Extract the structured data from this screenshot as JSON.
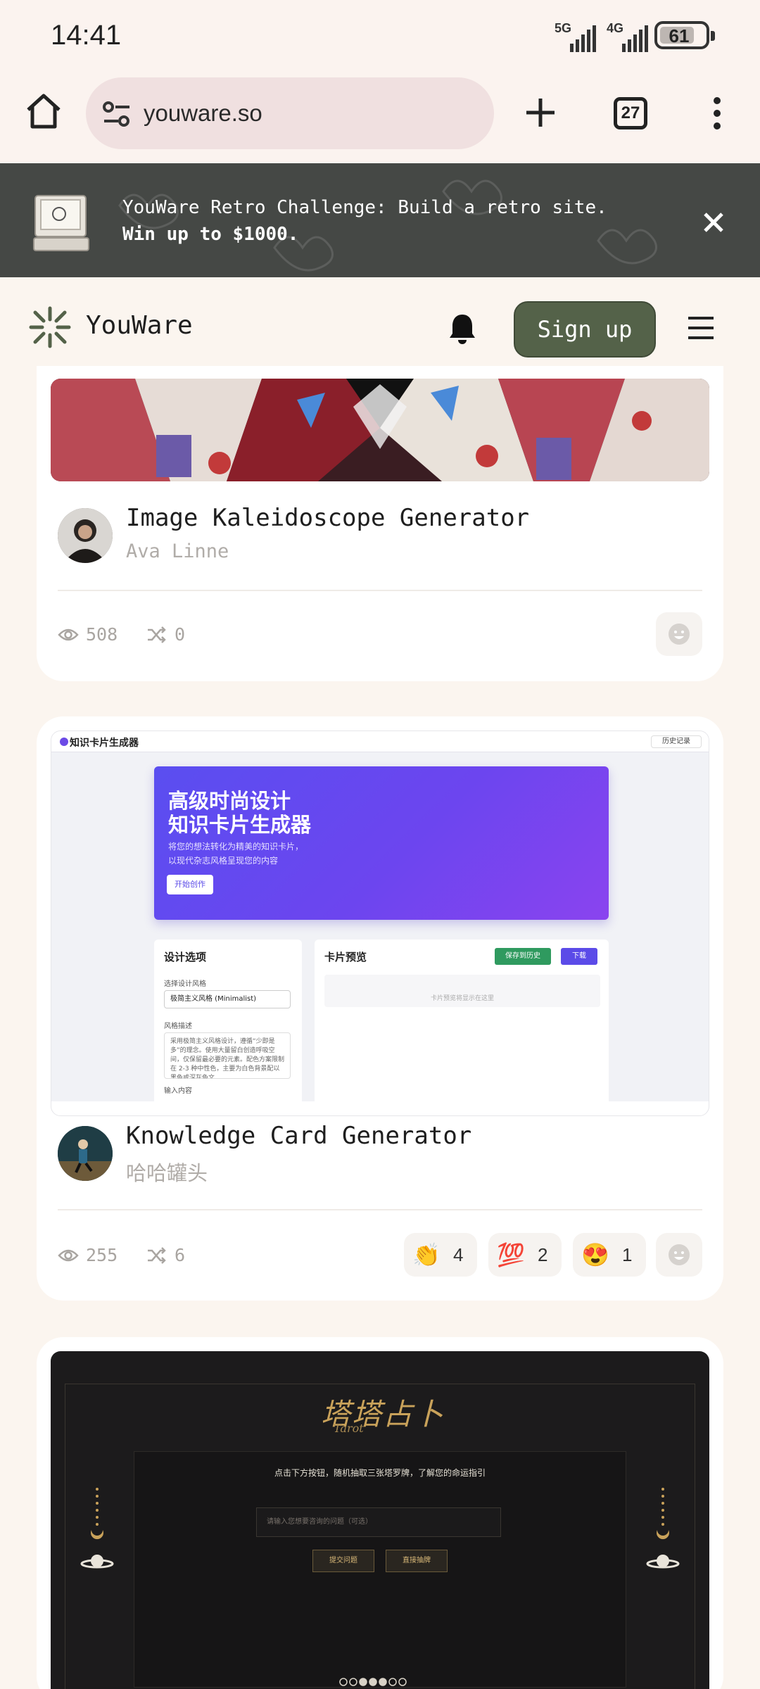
{
  "status_bar": {
    "time": "14:41",
    "net1": "5G",
    "net2": "4G",
    "battery": "61"
  },
  "browser": {
    "url": "youware.so",
    "tab_count": "27"
  },
  "banner": {
    "line1": "YouWare Retro Challenge: Build a retro site.",
    "line2": "Win up to $1000."
  },
  "header": {
    "brand": "YouWare",
    "signup": "Sign up"
  },
  "cards": [
    {
      "title": "Image Kaleidoscope Generator",
      "author": "Ava Linne",
      "views": "508",
      "remixes": "0"
    },
    {
      "title": "Knowledge Card Generator",
      "author": "哈哈罐头",
      "views": "255",
      "remixes": "6",
      "reactions": [
        {
          "emoji": "👏",
          "count": "4"
        },
        {
          "emoji": "💯",
          "count": "2"
        },
        {
          "emoji": "😍",
          "count": "1"
        }
      ],
      "preview": {
        "app_title": "知识卡片生成器",
        "history": "历史记录",
        "hero_title_1": "高级时尚设计",
        "hero_title_2": "知识卡片生成器",
        "hero_desc_1": "将您的想法转化为精美的知识卡片，",
        "hero_desc_2": "以现代杂志风格呈现您的内容",
        "hero_button": "开始创作",
        "design_title": "设计选项",
        "style_label": "选择设计风格",
        "style_value": "极简主义风格 (Minimalist)",
        "desc_label": "风格描述",
        "desc_text": "采用极简主义风格设计，遵循“少即是多”的理念。使用大量留白创造呼吸空间，仅保留最必要的元素。配色方案限制在 2-3 种中性色，主要为白色背景配以黑色或深灰色文",
        "input_label": "输入内容",
        "preview_title": "卡片预览",
        "save_btn": "保存到历史",
        "download_btn": "下载",
        "empty_text": "卡片预览将显示在这里"
      }
    },
    {
      "preview": {
        "logo_text": "塔塔占卜",
        "logo_sub": "Tarot",
        "prompt": "点击下方按钮，随机抽取三张塔罗牌，了解您的命运指引",
        "input_placeholder": "请输入您想要咨询的问题（可选）",
        "submit": "提交问题",
        "random": "直接抽牌"
      }
    }
  ],
  "colors": {
    "signup_bg": "#546249",
    "banner_bg": "#454845",
    "page_bg": "#fbf5ef"
  }
}
